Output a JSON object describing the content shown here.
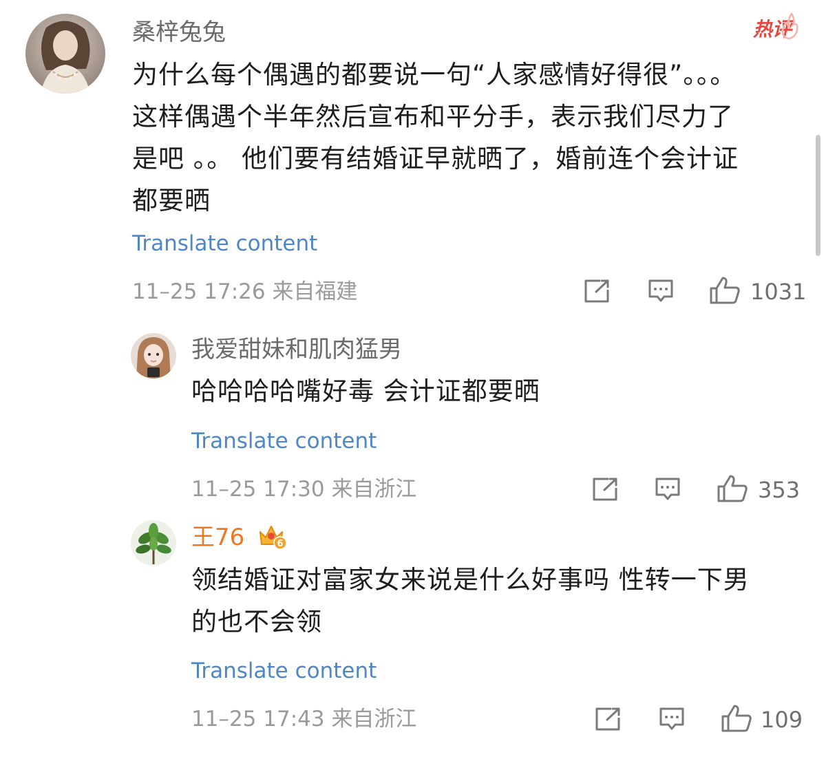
{
  "colors": {
    "name": "#6b6b6b",
    "vip_name": "#f0761f",
    "translate_link": "#4f86c6",
    "meta": "#9a9a9a",
    "hot_badge": "#e8473f"
  },
  "comment": {
    "author": "桑梓兔兔",
    "badge": "热评",
    "text_lines": [
      "为什么每个偶遇的都要说一句“人家感情好得很”。。。",
      "这样偶遇个半年然后宣布和平分手，表示我们尽力了",
      "是吧 。。 他们要有结婚证早就晒了，婚前连个会计证",
      "都要晒"
    ],
    "translate_label": "Translate content",
    "meta": "11–25 17:26 来自福建",
    "likes": "1031",
    "icons": [
      "share-icon",
      "comment-icon",
      "like-icon"
    ]
  },
  "replies": [
    {
      "author": "我爱甜妹和肌肉猛男",
      "text_lines": [
        "哈哈哈哈嘴好毒 会计证都要晒"
      ],
      "translate_label": "Translate content",
      "meta": "11–25 17:30 来自浙江",
      "likes": "353"
    },
    {
      "author": "王76",
      "vip_badge_level": "6",
      "text_lines": [
        "领结婚证对富家女来说是什么好事吗 性转一下男",
        "的也不会领"
      ],
      "translate_label": "Translate content",
      "meta": "11–25 17:43 来自浙江",
      "likes": "109"
    }
  ]
}
